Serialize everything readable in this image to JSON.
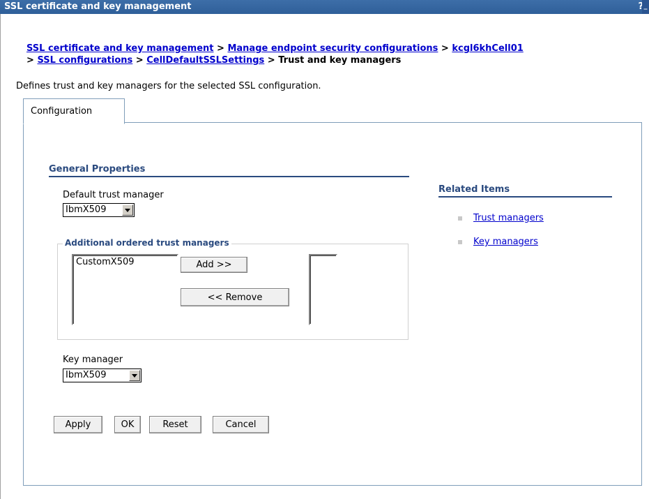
{
  "window": {
    "title": "SSL certificate and key management",
    "help": "?",
    "minimize": "_"
  },
  "breadcrumb": {
    "items": [
      "SSL certificate and key management",
      "Manage endpoint security configurations",
      "kcgl6khCell01",
      "SSL configurations",
      "CellDefaultSSLSettings"
    ],
    "separator": ">",
    "current": "Trust and key managers"
  },
  "description": "Defines trust and key managers for the selected SSL configuration.",
  "tabs": [
    {
      "label": "Configuration"
    }
  ],
  "general": {
    "title": "General Properties",
    "default_trust_manager_label": "Default trust manager",
    "default_trust_manager_value": "IbmX509",
    "additional_legend": "Additional ordered trust managers",
    "available_list": [
      "CustomX509"
    ],
    "selected_list": [],
    "add_button": "Add >>",
    "remove_button": "<< Remove",
    "key_manager_label": "Key manager",
    "key_manager_value": "IbmX509"
  },
  "buttons": {
    "apply": "Apply",
    "ok": "OK",
    "reset": "Reset",
    "cancel": "Cancel"
  },
  "related": {
    "title": "Related Items",
    "items": [
      {
        "label": "Trust managers"
      },
      {
        "label": "Key managers"
      }
    ]
  }
}
